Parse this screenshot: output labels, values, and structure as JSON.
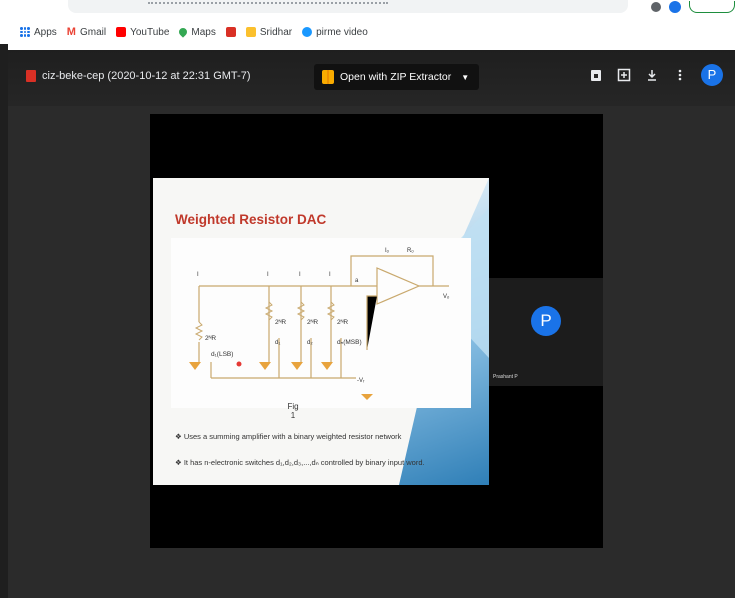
{
  "bookmarks": {
    "apps": "Apps",
    "gmail": "Gmail",
    "youtube": "YouTube",
    "maps": "Maps",
    "sridhar": "Sridhar",
    "prime": "pirme video"
  },
  "viewer": {
    "file_title": "ciz-beke-cep (2020-10-12 at 22:31 GMT-7)",
    "open_with": "Open with ZIP Extractor",
    "avatar": "P"
  },
  "slide": {
    "title": "Weighted Resistor DAC",
    "fig": "Fig\n1",
    "bullet1": "Uses a summing amplifier with a binary weighted resistor network",
    "bullet2": "It has n-electronic switches d₁,d₂,d₃,...,dₙ controlled by binary input word.",
    "circuit": {
      "lsb": "d₁(LSB)",
      "msb": "dₙ(MSB)",
      "vr": "-Vᵣ",
      "vo": "Vₒ",
      "rf": "Rₒ",
      "io": "Iₒ",
      "a": "a"
    }
  },
  "participant": {
    "avatar": "P",
    "name": "Prashant P"
  }
}
